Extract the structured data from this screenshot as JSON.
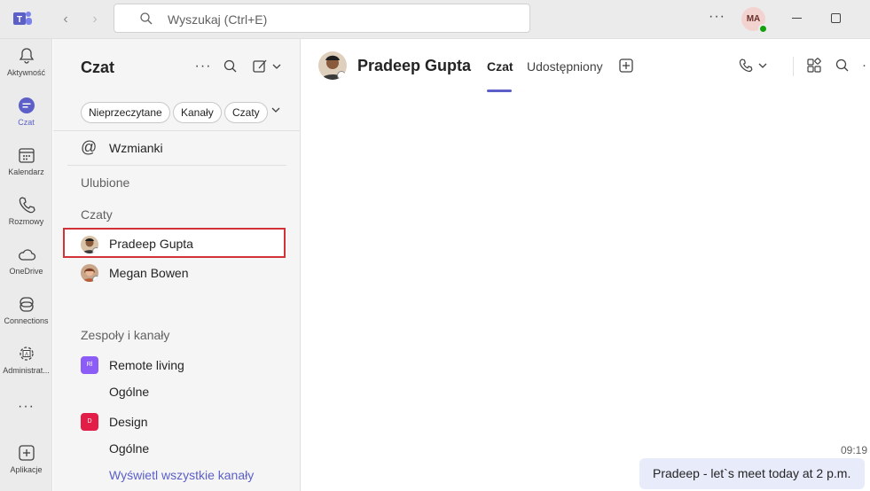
{
  "titlebar": {
    "search_placeholder": "Wyszukaj (Ctrl+E)",
    "back_arrow": "‹",
    "forward_arrow": "›",
    "more": "···",
    "user_initials": "MA"
  },
  "rail": {
    "items": [
      {
        "label": "Aktywność",
        "icon": "bell-icon"
      },
      {
        "label": "Czat",
        "icon": "chat-icon",
        "active": true
      },
      {
        "label": "Kalendarz",
        "icon": "calendar-icon"
      },
      {
        "label": "Rozmowy",
        "icon": "phone-icon"
      },
      {
        "label": "OneDrive",
        "icon": "cloud-icon"
      },
      {
        "label": "Connections",
        "icon": "connections-icon"
      },
      {
        "label": "Administrat...",
        "icon": "admin-icon"
      },
      {
        "label": "Aplikacje",
        "icon": "add-app-icon"
      }
    ],
    "more": "···"
  },
  "chatlist": {
    "title": "Czat",
    "filters": [
      "Nieprzeczytane",
      "Kanały",
      "Czaty"
    ],
    "mentions": "Wzmianki",
    "favorites_header": "Ulubione",
    "chats_header": "Czaty",
    "chats": [
      {
        "name": "Pradeep Gupta"
      },
      {
        "name": "Megan Bowen"
      }
    ],
    "teams_header": "Zespoły i kanały",
    "teams": [
      {
        "name": "Remote living",
        "initials": "Rl",
        "color": "#8b5cf6",
        "channel": "Ogólne"
      },
      {
        "name": "Design",
        "initials": "D",
        "color": "#e11d48",
        "channel": "Ogólne"
      }
    ],
    "show_all": "Wyświetl wszystkie kanały"
  },
  "conversation": {
    "name": "Pradeep Gupta",
    "tabs": [
      "Czat",
      "Udostępniony"
    ],
    "message_time": "09:19",
    "message_text": "Pradeep - let`s meet today at  2 p.m."
  },
  "colors": {
    "accent": "#5b5fc7",
    "highlight_border": "#d13438",
    "bubble": "#e8ebfa"
  }
}
